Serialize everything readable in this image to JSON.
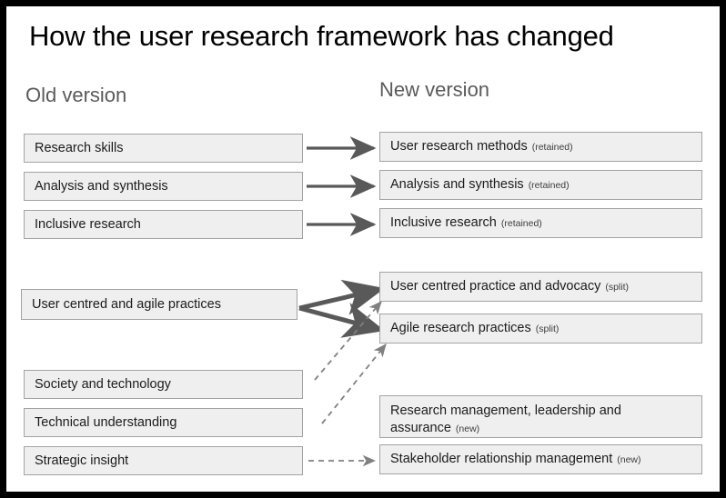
{
  "slide": {
    "title": "How the user research framework has changed",
    "columns": {
      "old_label": "Old version",
      "new_label": "New version"
    },
    "colors": {
      "frame": "#000000",
      "box_fill": "#efefef",
      "box_border": "#a3a3a3",
      "heading_text": "#5a5a5a",
      "title_text": "#000000",
      "solid_arrow": "#595959",
      "dashed_arrow": "#808080"
    }
  },
  "old_version": {
    "items": [
      {
        "label": "Research skills"
      },
      {
        "label": "Analysis and synthesis"
      },
      {
        "label": "Inclusive research"
      },
      {
        "label": "User centred and agile practices"
      },
      {
        "label": "Society and technology"
      },
      {
        "label": "Technical understanding"
      },
      {
        "label": "Strategic insight"
      }
    ]
  },
  "new_version": {
    "items": [
      {
        "label": "User research methods",
        "tag": "(retained)"
      },
      {
        "label": "Analysis and synthesis",
        "tag": "(retained)"
      },
      {
        "label": "Inclusive research",
        "tag": "(retained)"
      },
      {
        "label": "User centred practice and advocacy",
        "tag": "(split)"
      },
      {
        "label": "Agile research practices",
        "tag": "(split)"
      },
      {
        "label": "Research management, leadership and assurance",
        "tag": "(new)"
      },
      {
        "label": "Stakeholder relationship management",
        "tag": "(new)"
      }
    ]
  },
  "connections": [
    {
      "from": "Research skills",
      "to": "User research methods",
      "style": "solid"
    },
    {
      "from": "Analysis and synthesis",
      "to": "Analysis and synthesis",
      "style": "solid"
    },
    {
      "from": "Inclusive research",
      "to": "Inclusive research",
      "style": "solid"
    },
    {
      "from": "User centred and agile practices",
      "to": "User centred practice and advocacy",
      "style": "solid-thick"
    },
    {
      "from": "User centred and agile practices",
      "to": "Agile research practices",
      "style": "solid-thick"
    },
    {
      "from": "Society and technology",
      "to": "User centred practice and advocacy",
      "style": "dashed"
    },
    {
      "from": "Technical understanding",
      "to": "Agile research practices",
      "style": "dashed"
    },
    {
      "from": "Strategic insight",
      "to": "Stakeholder relationship management",
      "style": "dashed"
    }
  ]
}
